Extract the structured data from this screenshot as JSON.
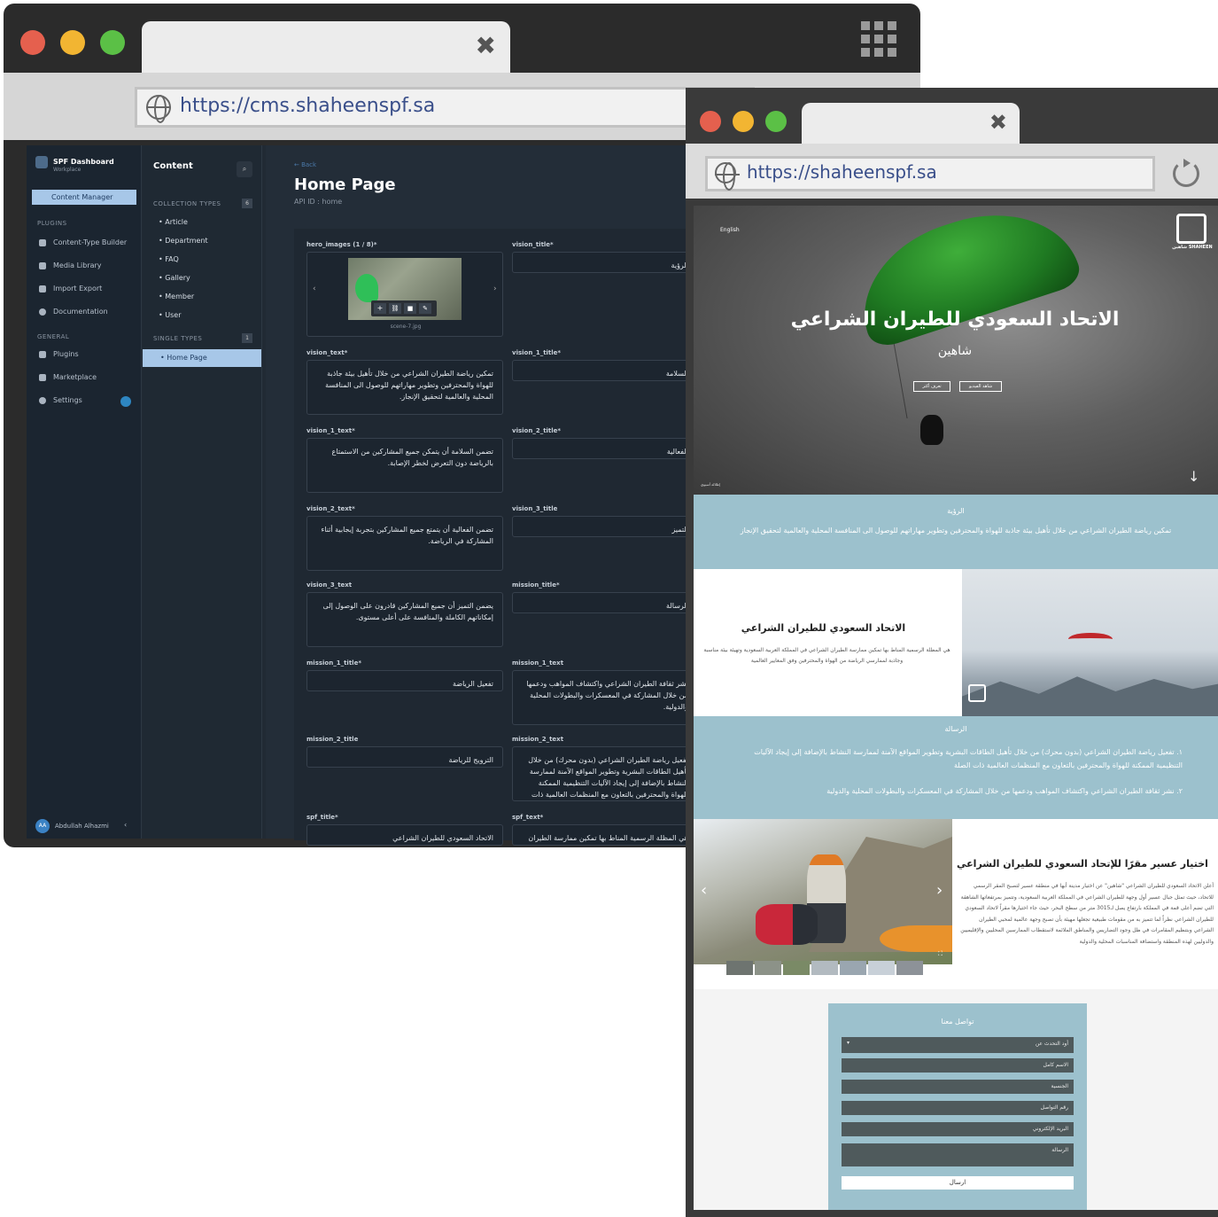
{
  "cms_browser": {
    "url": "https://cms.shaheenspf.sa",
    "dashboard": {
      "app_title": "SPF Dashboard",
      "app_subtitle": "Workplace",
      "active_item": "Content Manager",
      "plugins_label": "PLUGINS",
      "plugins": [
        "Content-Type Builder",
        "Media Library",
        "Import Export",
        "Documentation"
      ],
      "general_label": "GENERAL",
      "general": [
        "Plugins",
        "Marketplace",
        "Settings"
      ],
      "user_initials": "AA",
      "user_name": "Abdullah Alhazmi"
    },
    "content_panel": {
      "title": "Content",
      "collection_types_label": "COLLECTION TYPES",
      "collection_count": "6",
      "collection_types": [
        "Article",
        "Department",
        "FAQ",
        "Gallery",
        "Member",
        "User"
      ],
      "single_types_label": "SINGLE TYPES",
      "single_count": "1",
      "single_types": [
        "Home Page"
      ]
    },
    "editor": {
      "back": "← Back",
      "title": "Home Page",
      "api_id": "API ID : home",
      "image_field_label": "hero_images (1 / 8)*",
      "image_caption": "scene-7.jpg",
      "fields_left": [
        {
          "label": "vision_text*",
          "value": "تمكين رياضة الطيران الشراعي من خلال تأهيل بيئة جاذبة للهواة والمحترفين وتطوير مهاراتهم للوصول الى المنافسة المحلية والعالمية لتحقيق الإنجاز."
        },
        {
          "label": "vision_1_text*",
          "value": "تضمن السلامة أن يتمكن جميع المشاركين من الاستمتاع بالرياضة دون التعرض لخطر الإصابة."
        },
        {
          "label": "vision_2_text*",
          "value": "تضمن الفعالية أن يتمتع جميع المشاركين بتجربة إيجابية أثناء المشاركة في الرياضة."
        },
        {
          "label": "vision_3_text",
          "value": "يضمن التميز أن جميع المشاركين قادرون على الوصول إلى إمكاناتهم الكاملة والمنافسة على أعلى مستوى."
        },
        {
          "label": "mission_1_title*",
          "value": "تفعيل الرياضة"
        },
        {
          "label": "mission_2_title",
          "value": "الترويج للرياضة"
        },
        {
          "label": "spf_title*",
          "value": "الاتحاد السعودي للطيران الشراعي"
        }
      ],
      "fields_right": [
        {
          "label": "vision_title*",
          "value": "الرؤية"
        },
        {
          "label": "vision_1_title*",
          "value": "السلامة"
        },
        {
          "label": "vision_2_title*",
          "value": "الفعالية"
        },
        {
          "label": "vision_3_title",
          "value": "التميز"
        },
        {
          "label": "mission_title*",
          "value": "الرسالة"
        },
        {
          "label": "mission_1_text",
          "value": "نشر ثقافة الطيران الشراعي واكتشاف المواهب ودعمها من خلال المشاركة في المعسكرات والبطولات المحلية والدولية."
        },
        {
          "label": "mission_2_text",
          "value": "تفعيل رياضة الطيران الشراعي (بدون محرك) من خلال تأهيل الطاقات البشرية وتطوير المواقع الآمنة لممارسة النشاط بالإضافة إلى إيجاد الآليات التنظيمية الممكنة للهواة والمحترفين بالتعاون مع المنظمات العالمية ذات الصلة."
        },
        {
          "label": "spf_text*",
          "value": "هي المظلة الرسمية المناط بها تمكين ممارسة الطيران"
        }
      ]
    }
  },
  "site_browser": {
    "url": "https://shaheenspf.sa",
    "hero": {
      "lang_link": "English",
      "logo_text": "شاهين SHAHEEN",
      "title": "الاتحاد السعودي للطيران الشراعي",
      "subtitle": "شاهين",
      "btn_more": "تعرف أكثر",
      "btn_join": "شاهد الفيديو",
      "credit": "إطلالة أسيوي",
      "scroll_icon": "arrow-down"
    },
    "vision": {
      "title": "الرؤية",
      "text": "تمكين رياضة الطيران الشراعي من خلال تأهيل بيئة جاذبة للهواة والمحترفين وتطوير مهاراتهم للوصول الى المنافسة المحلية والعالمية لتحقيق الإنجاز"
    },
    "about": {
      "title": "الاتحاد السعودي للطيران الشراعي",
      "text": "هي المظلة الرسمية المناط بها تمكين ممارسة الطيران الشراعي في المملكة العربية السعودية وتهيئة بيئة مناسبة وجاذبة لممارسي الرياضة من الهواة والمحترفين وفق المعايير العالمية"
    },
    "mission": {
      "title": "الرسالة",
      "items": [
        "١. تفعيل رياضة الطيران الشراعي (بدون محرك) من خلال تأهيل الطاقات البشرية وتطوير المواقع الآمنة لممارسة النشاط بالإضافة إلى إيجاد الآليات التنظيمية الممكنة للهواة والمحترفين بالتعاون مع المنظمات العالمية ذات الصلة",
        "٢. نشر ثقافة الطيران الشراعي واكتشاف المواهب ودعمها من خلال المشاركة في المعسكرات والبطولات المحلية والدولية"
      ]
    },
    "asir": {
      "title": "اختيار عسير مقرًا للإتحاد السعودي للطيران الشراعي",
      "text": "أعلن الاتحاد السعودي للطيران الشراعي \"شاهين\" عن اختيار مدينة أبها في منطقة عسير لتصبح المقر الرسمي للاتحاد، حيث تمثل جبال عسير أول وجهة للطيران الشراعي في المملكة العربية السعودية، وتتميز بمرتفعاتها الشاهقة التي تضم أعلى قمة في المملكة بارتفاع يصل لـ3015 متر من سطح البحر، حيث جاء اختيارها مقراً لاتحاد السعودي للطيران الشراعي نظراً لما تتميز به من مقومات طبيعية تجعلها مهيئة بأن تصبح وجهة عالمية لمحبي الطيران الشراعي وبتنظيم المقامرات في ظل وجود التضاريس والمناطق الملائمة لاستقطاب الممارسين المحليين والإقليميين والدوليين لهذه المنطقة واستضافة المناسبات المحلية والدولية"
    },
    "contact": {
      "title": "تواصل معنا",
      "select_placeholder": "أود التحدث عن",
      "fields": [
        "الاسم كامل",
        "الجنسية",
        "رقم التواصل",
        "البريد الإلكتروني"
      ],
      "message": "الرسالة",
      "submit": "ارسال"
    }
  }
}
